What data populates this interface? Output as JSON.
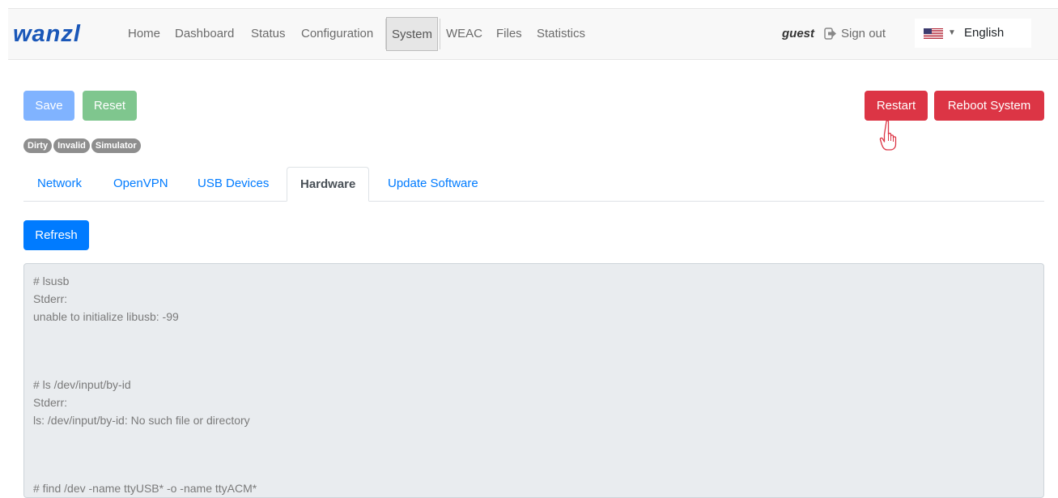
{
  "navbar": {
    "logo": "wanzl",
    "items": [
      {
        "label": "Home"
      },
      {
        "label": "Dashboard"
      },
      {
        "label": "Status"
      },
      {
        "label": "Configuration"
      },
      {
        "label": "System"
      },
      {
        "label": "WEAC"
      },
      {
        "label": "Files"
      },
      {
        "label": "Statistics"
      }
    ],
    "user": "guest",
    "signout_label": "Sign out",
    "language": "English"
  },
  "actions": {
    "save_label": "Save",
    "reset_label": "Reset",
    "restart_label": "Restart",
    "reboot_label": "Reboot System"
  },
  "badges": [
    "Dirty",
    "Invalid",
    "Simulator"
  ],
  "tabs": [
    {
      "label": "Network"
    },
    {
      "label": "OpenVPN"
    },
    {
      "label": "USB Devices"
    },
    {
      "label": "Hardware"
    },
    {
      "label": "Update Software"
    }
  ],
  "refresh_label": "Refresh",
  "console": {
    "blocks": [
      {
        "lines": [
          "# lsusb",
          "Stderr:",
          "unable to initialize libusb: -99"
        ]
      },
      {
        "lines": [
          "# ls /dev/input/by-id",
          "Stderr:",
          "ls: /dev/input/by-id: No such file or directory"
        ]
      },
      {
        "lines": [
          "# find /dev -name ttyUSB* -o -name ttyACM*"
        ]
      }
    ]
  },
  "colors": {
    "primary": "#007bff",
    "danger": "#dc3545",
    "success_light": "#7fc68e",
    "primary_light": "#80b3ff",
    "logo": "#1a57b8"
  }
}
